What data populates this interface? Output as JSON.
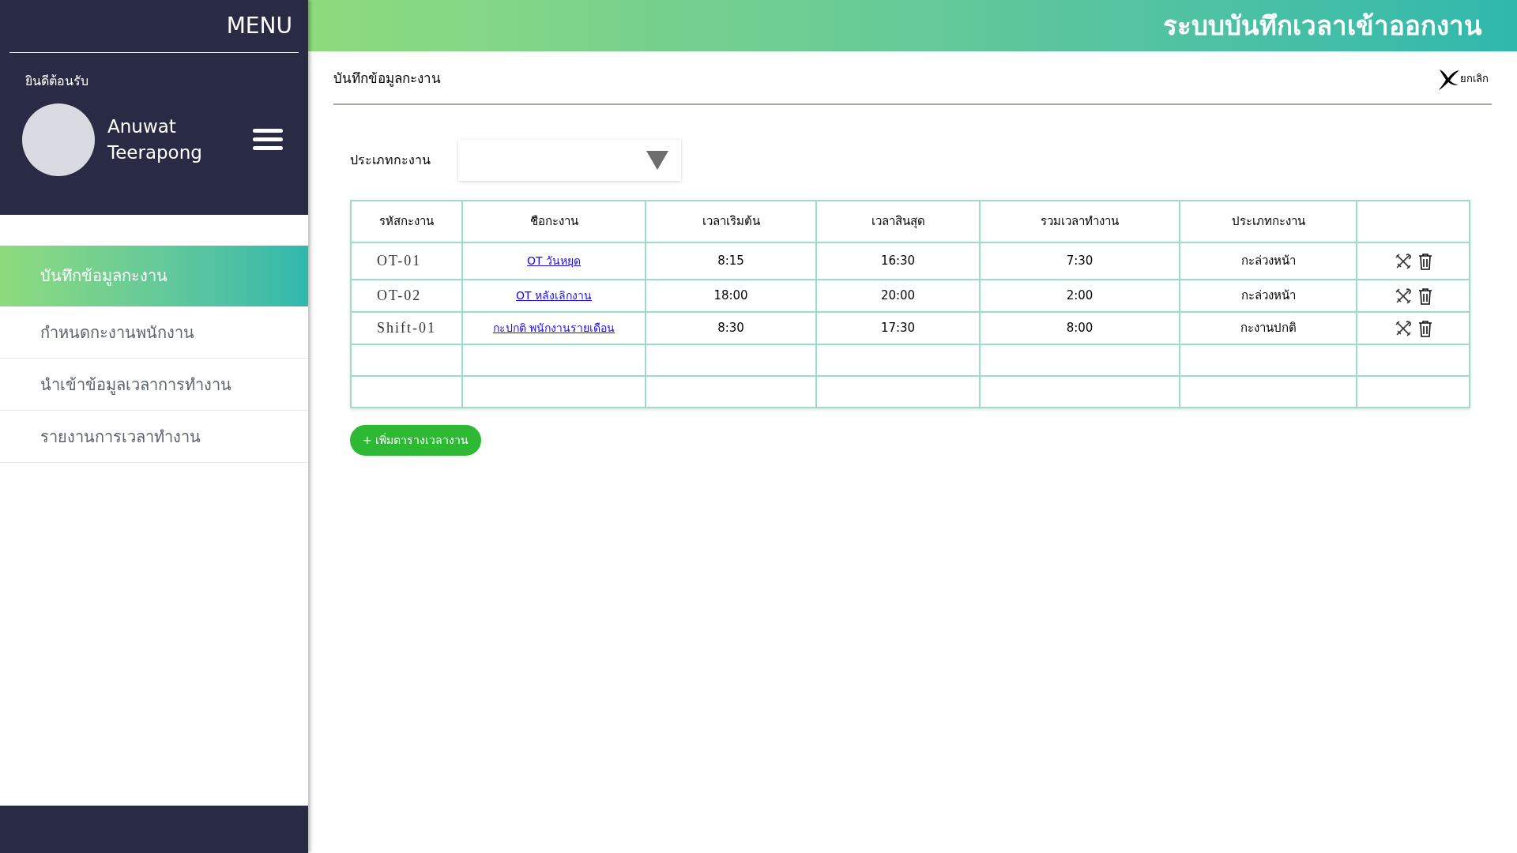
{
  "sidebar": {
    "title": "MENU",
    "welcome": "ยินดีต้อนรับ",
    "user": {
      "first_name": "Anuwat",
      "last_name": "Teerapong"
    },
    "items": [
      {
        "label": "บันทึกข้อมูลกะงาน",
        "selected": true
      },
      {
        "label": "กำหนดกะงานพนักงาน",
        "selected": false
      },
      {
        "label": "นำเข้าข้อมูลเวลาการทำงาน",
        "selected": false
      },
      {
        "label": "รายงานการเวลาทำงาน",
        "selected": false
      }
    ]
  },
  "header": {
    "title": "ระบบบันทึกเวลาเข้าออกงาน"
  },
  "page": {
    "title": "บันทึกข้อมูลกะงาน",
    "cancel": "ยกเลิก"
  },
  "filter": {
    "label": "ประเภทกะงาน"
  },
  "table": {
    "columns": [
      "รหัสกะงาน",
      "ชือกะงาน",
      "เวลาเริมต้น",
      "เวลาสินสุด",
      "รวมเวลาทำงาน",
      "ประเภทกะงาน"
    ],
    "rows": [
      {
        "code": "OT-01",
        "name": "OT วันหยุด",
        "start": "8:15",
        "end": "16:30",
        "total": "7:30",
        "type": "กะล่วงหน้า"
      },
      {
        "code": "OT-02",
        "name": "OT หลังเลิกงาน",
        "start": "18:00",
        "end": "20:00",
        "total": "2:00",
        "type": "กะล่วงหน้า"
      },
      {
        "code": "Shift-01",
        "name": "กะปกติ พนักงานรายเดือน",
        "start": "8:30",
        "end": "17:30",
        "total": "8:00",
        "type": "กะงานปกติ"
      }
    ]
  },
  "add_button": "+ เพิ่มตารางเวลางาน"
}
